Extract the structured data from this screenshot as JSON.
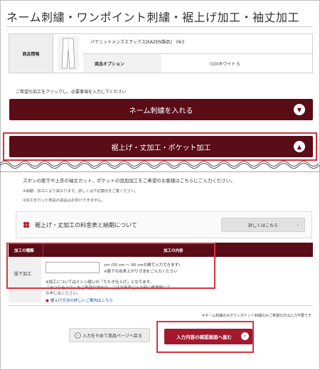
{
  "page": {
    "title": "ネーム刺繍・ワンポイント刺繍・裾上げ加工・袖丈加工"
  },
  "product": {
    "header": "商品情報",
    "name": "パナニットメンズスラックス[KAZEN製品]　063",
    "option_label": "商品オプション",
    "option_value": "(10)ホワイト S",
    "image_icon": "pants-thumbnail-icon"
  },
  "instruction": "ご希望の加工をクリックし、必要事項を入力してください",
  "accordions": [
    {
      "label": "ネーム刺繍を入れる",
      "icon": "chevron-down-icon"
    },
    {
      "label": "裾上げ・丈加工・ポケット加工",
      "icon": "chevron-up-icon"
    }
  ],
  "section": {
    "desc": "ズボンの股下や上衣の袖丈カット、ポケットの追加加工をご希望のお客様はこちらにご入力ください。",
    "note1": "※納期：加工により異なります。詳しくは下記案内をご覧ください。",
    "note2": "※加工を行った商品の返品はお受けできません。",
    "price_title": "裾上げ・丈加工の料金表と納期について",
    "price_button": "詳しくはこちら",
    "price_button_arrow": "›"
  },
  "table": {
    "col1": "加工の種類",
    "col2": "加工の内容",
    "row_label": "股下加工",
    "input_value": "",
    "cm_note": "cm (50 cm 〜 90 cmの間で入力できます)",
    "cm_note2": "※股下の出来上がり寸法をご入力ください",
    "note1": "※加工についてはミシン縫いの「たたき仕上げ」となります。",
    "note2": "「まつり仕上げ」をご希望の場合は、ご注文画面ご入力時に備考欄にて",
    "note3": "お申し出ください。",
    "link": "裾上げ方法の詳しいご案内はこちら"
  },
  "footnote": "※ネーム刺繍のみやワンポイント刺繍のみご希望の方は入力不要です",
  "buttons": {
    "back": "入力をやめて商品ページへ戻る",
    "back_arrow": "‹",
    "confirm": "入力内容の確認画面へ進む",
    "confirm_arrow": "›"
  },
  "colors": {
    "accent": "#5a0c17",
    "confirm": "#a3182d",
    "highlight": "#d9323e"
  }
}
